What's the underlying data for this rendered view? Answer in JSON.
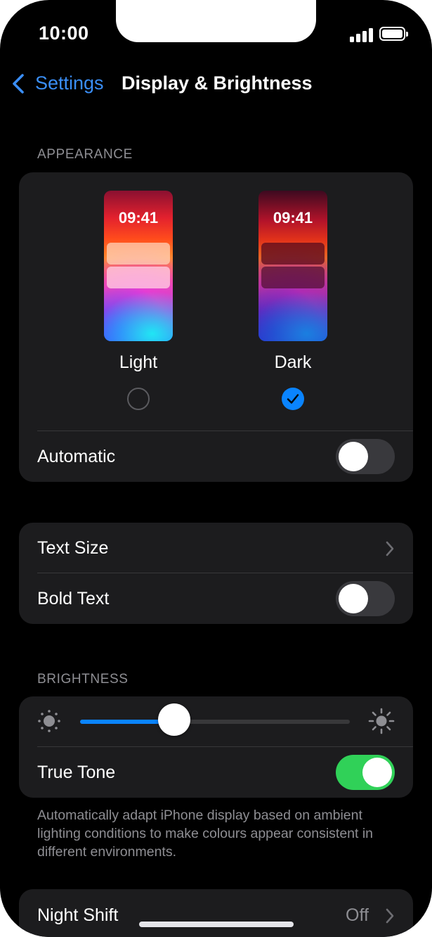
{
  "status_bar": {
    "time": "10:00",
    "signal_icon": "cellular-signal-icon",
    "battery_icon": "battery-full-icon"
  },
  "nav": {
    "back_label": "Settings",
    "title": "Display & Brightness"
  },
  "appearance": {
    "header": "APPEARANCE",
    "options": [
      {
        "label": "Light",
        "preview_time": "09:41",
        "selected": false
      },
      {
        "label": "Dark",
        "preview_time": "09:41",
        "selected": true
      }
    ],
    "automatic": {
      "label": "Automatic",
      "on": false
    }
  },
  "text_group": {
    "text_size_label": "Text Size",
    "bold_text": {
      "label": "Bold Text",
      "on": false
    }
  },
  "brightness": {
    "header": "BRIGHTNESS",
    "level_fraction": 0.35,
    "true_tone": {
      "label": "True Tone",
      "on": true
    },
    "footnote": "Automatically adapt iPhone display based on ambient lighting conditions to make colours appear consistent in different environments."
  },
  "night_shift": {
    "label": "Night Shift",
    "value": "Off"
  },
  "colors": {
    "accent": "#0A84FF",
    "toggle_on": "#30D158",
    "background": "#000000",
    "card": "#1C1C1E",
    "secondary_text": "#8E8E93"
  }
}
